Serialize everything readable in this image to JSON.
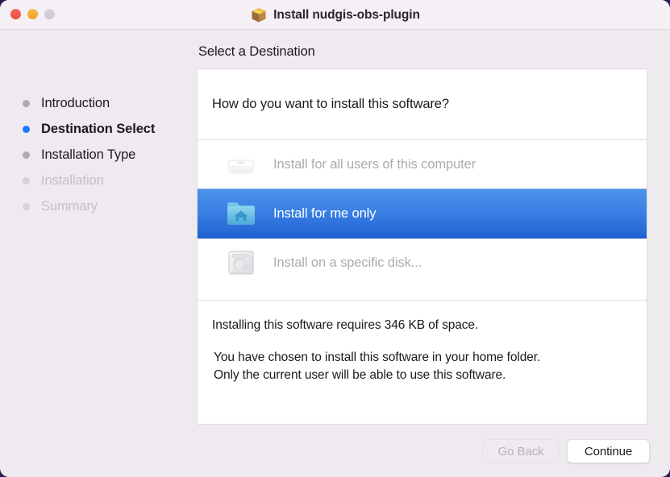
{
  "window": {
    "title": "Install nudgis-obs-plugin",
    "title_icon": "package-box-icon",
    "traffic_lights": {
      "close": "close-button",
      "minimize": "minimize-button",
      "zoom": "zoom-button",
      "close_color": "#f0564d",
      "minimize_color": "#f5ab32",
      "zoom_color": "#d2cfd4"
    },
    "background_color": "#efeaf0"
  },
  "sidebar": {
    "steps": [
      {
        "label": "Introduction",
        "state": "done"
      },
      {
        "label": "Destination Select",
        "state": "current"
      },
      {
        "label": "Installation Type",
        "state": "done"
      },
      {
        "label": "Installation",
        "state": "pending"
      },
      {
        "label": "Summary",
        "state": "pending"
      }
    ],
    "current_bullet_color": "#1a7aff",
    "bullet_color": "#adaab0",
    "pending_color": "#c3bfc6"
  },
  "main": {
    "heading": "Select a Destination",
    "question": "How do you want to install this software?",
    "options": [
      {
        "label": "Install for all users of this computer",
        "icon": "computer-icon",
        "selected": false,
        "enabled": false
      },
      {
        "label": "Install for me only",
        "icon": "home-folder-icon",
        "selected": true,
        "enabled": true
      },
      {
        "label": "Install on a specific disk...",
        "icon": "hard-disk-icon",
        "selected": false,
        "enabled": false
      }
    ],
    "space_required": "Installing this software requires 346 KB of space.",
    "chosen_line_1": "You have chosen to install this software in your home folder.",
    "chosen_line_2": "Only the current user will be able to use this software.",
    "selection_color": "#3a81e4"
  },
  "footer": {
    "go_back_label": "Go Back",
    "go_back_enabled": false,
    "continue_label": "Continue",
    "continue_enabled": true
  }
}
